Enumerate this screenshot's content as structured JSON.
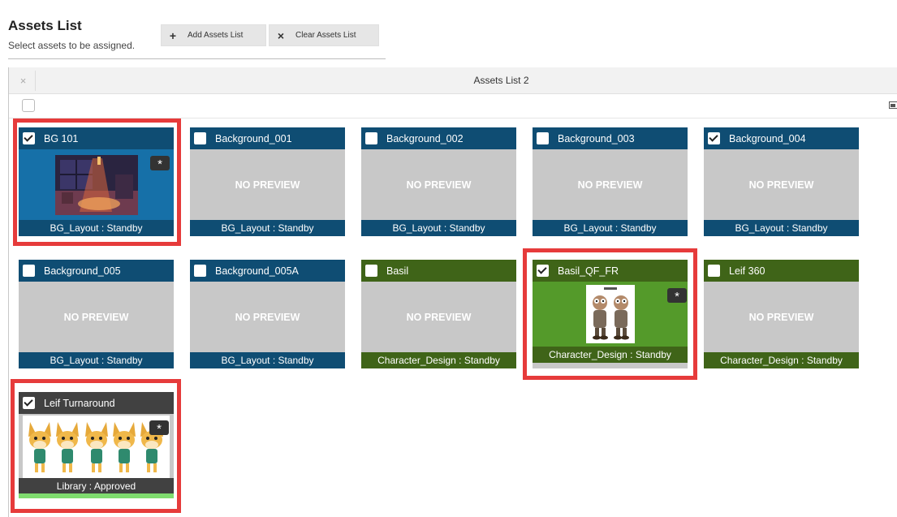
{
  "header": {
    "title": "Assets List",
    "subtitle": "Select assets to be assigned.",
    "add_label": "Add Assets List",
    "clear_label": "Clear Assets List",
    "add_icon": "+",
    "clear_icon": "×"
  },
  "panel": {
    "title": "Assets List 2",
    "close_icon": "×"
  },
  "cards": [
    {
      "name": "BG 101",
      "checked": true,
      "status": "BG_Layout : Standby",
      "preview": "background-thumbnail",
      "highlighted": true
    },
    {
      "name": "Background_001",
      "checked": false,
      "status": "BG_Layout : Standby",
      "preview": "NO PREVIEW"
    },
    {
      "name": "Background_002",
      "checked": false,
      "status": "BG_Layout : Standby",
      "preview": "NO PREVIEW"
    },
    {
      "name": "Background_003",
      "checked": false,
      "status": "BG_Layout : Standby",
      "preview": "NO PREVIEW"
    },
    {
      "name": "Background_004",
      "checked": true,
      "status": "BG_Layout : Standby",
      "preview": "NO PREVIEW"
    },
    {
      "name": "Background_005",
      "checked": false,
      "status": "BG_Layout : Standby",
      "preview": "NO PREVIEW"
    },
    {
      "name": "Background_005A",
      "checked": false,
      "status": "BG_Layout : Standby",
      "preview": "NO PREVIEW"
    },
    {
      "name": "Basil",
      "checked": false,
      "status": "Character_Design : Standby",
      "preview": "NO PREVIEW"
    },
    {
      "name": "Basil_QF_FR",
      "checked": true,
      "status": "Character_Design : Standby",
      "preview": "character-thumbnail",
      "highlighted": true
    },
    {
      "name": "Leif 360",
      "checked": false,
      "status": "Character_Design : Standby",
      "preview": "NO PREVIEW"
    },
    {
      "name": "Leif Turnaround",
      "checked": true,
      "status": "Library : Approved",
      "preview": "turnaround-thumbnail",
      "highlighted": true
    }
  ],
  "star_label": "*",
  "colors": {
    "bg_layout": "#0f4d73",
    "character_design": "#3f6418",
    "library": "#414141",
    "approved_bar": "#7fdc6e",
    "highlight": "#e63b3b",
    "no_preview_bg": "#c8c8c8"
  }
}
